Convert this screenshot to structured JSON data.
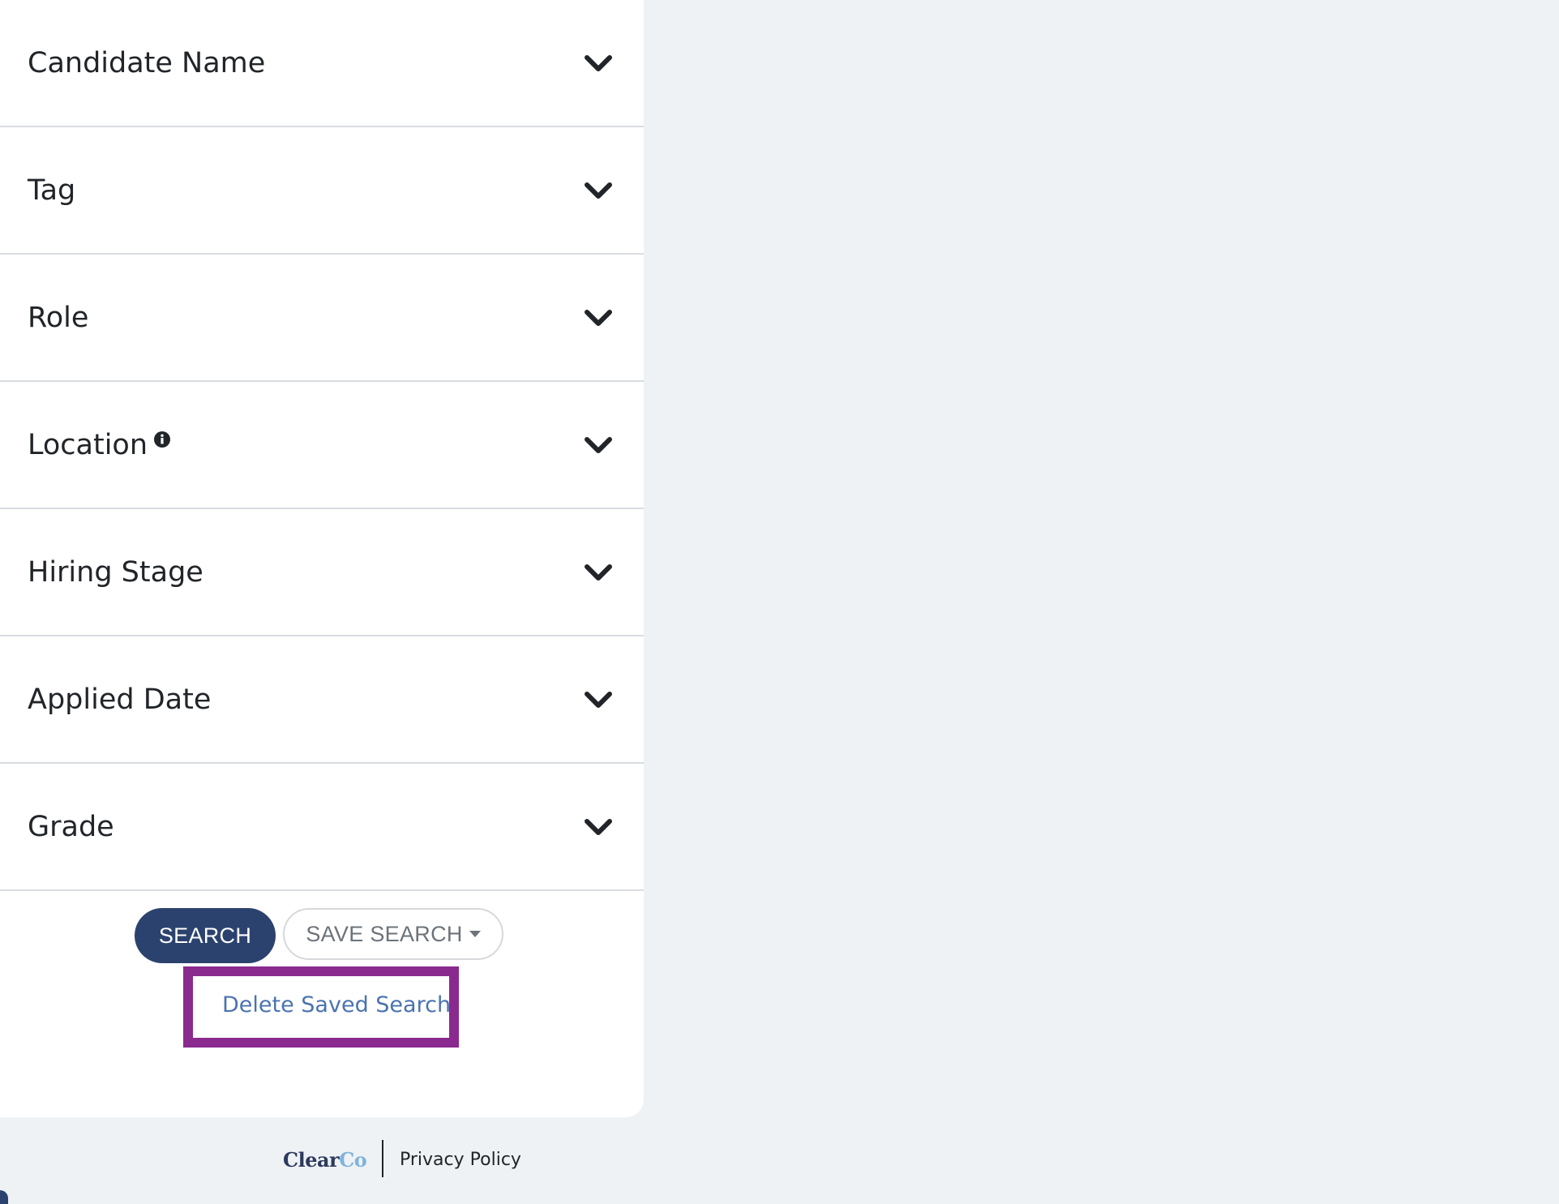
{
  "filters": [
    {
      "label": "Candidate Name"
    },
    {
      "label": "Tag"
    },
    {
      "label": "Role"
    },
    {
      "label": "Location"
    },
    {
      "label": "Hiring Stage"
    },
    {
      "label": "Applied Date"
    },
    {
      "label": "Grade"
    }
  ],
  "actions": {
    "search_label": "SEARCH",
    "save_search_label": "SAVE SEARCH",
    "dropdown": {
      "items": [
        "Delete Saved Search"
      ]
    }
  },
  "footer": {
    "logo_main": "Clear",
    "logo_accent": "Co",
    "privacy_label": "Privacy Policy"
  },
  "colors": {
    "primary": "#2c426e",
    "link": "#4a73b0",
    "highlight": "#8a2a8e",
    "background": "#eff2f5"
  }
}
